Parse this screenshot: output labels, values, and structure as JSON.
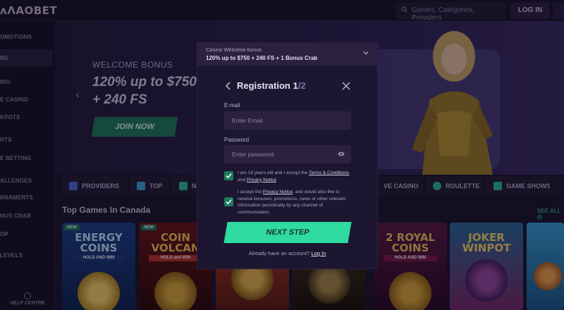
{
  "header": {
    "logo": "ʌΛAOBET",
    "search_placeholder": "Games, Categories, Providers",
    "login_label": "LOG IN"
  },
  "sidebar": {
    "items": [
      {
        "label": "OMOTIONS"
      },
      {
        "label": "ME"
      },
      {
        "label": "INO"
      },
      {
        "label": "E CASINO"
      },
      {
        "label": "KPOTS"
      },
      {
        "label": "RTS"
      },
      {
        "label": "E BETTING"
      },
      {
        "label": "ALLENGES"
      },
      {
        "label": "RNAMENTS"
      },
      {
        "label": "NUS CRAB"
      },
      {
        "label": "OP"
      },
      {
        "label": "LEVELS"
      }
    ],
    "help_label": "HELP CENTRE"
  },
  "hero": {
    "bonus_label": "WELCOME BONUS",
    "bonus_title": "120% up to $750 + 240 FS",
    "join_label": "JOIN NOW"
  },
  "categories": [
    {
      "label": "PROVIDERS"
    },
    {
      "label": "TOP"
    },
    {
      "label": "N"
    },
    {
      "label": "VE CASINO"
    },
    {
      "label": "ROULETTE"
    },
    {
      "label": "GAME SHOWS"
    },
    {
      "label": ""
    }
  ],
  "games_section": {
    "title": "Top Games In Canada",
    "see_all": "SEE ALL (5"
  },
  "games": [
    {
      "name": "ENERGY COINS",
      "sub": "HOLD AND WIN",
      "badge": "NEW"
    },
    {
      "name": "COIN VOLCAN",
      "sub": "HOLD and WIN",
      "badge": "NEW"
    },
    {
      "name": "",
      "sub": "",
      "badge": ""
    },
    {
      "name": "",
      "sub": "",
      "badge": ""
    },
    {
      "name": "2 ROYAL COINS",
      "sub": "HOLD AND WIN",
      "badge": ""
    },
    {
      "name": "JOKER WINPOT",
      "sub": "",
      "badge": ""
    },
    {
      "name": "",
      "sub": "",
      "badge": ""
    }
  ],
  "modal": {
    "bonus_caption": "Casino Welcome bonus",
    "bonus_offer": "120% up to $750 + 240 FS + 1 Bonus Crab",
    "title": "Registration",
    "step": "1",
    "step_total": "/2",
    "email_label": "E-mail",
    "email_placeholder": "Enter Email",
    "password_label": "Password",
    "password_placeholder": "Enter password",
    "consent1_a": "I am 18 years old and I accept the ",
    "consent1_link1": "Terms & Conditions",
    "consent1_b": " and ",
    "consent1_link2": "Privacy Notice",
    "consent2_a": "I accept the ",
    "consent2_link": "Privacy Notice",
    "consent2_b": ", and would also like to receive bonuses, promotions, news or other relevant information periodically by any channel of communication.",
    "next_label": "NEXT STEP",
    "already_text": "Already have an account? ",
    "login_link": "Log In"
  },
  "colors": {
    "accent": "#2fdba0",
    "checkbox": "#1f7a5e",
    "background": "#1c1530"
  }
}
